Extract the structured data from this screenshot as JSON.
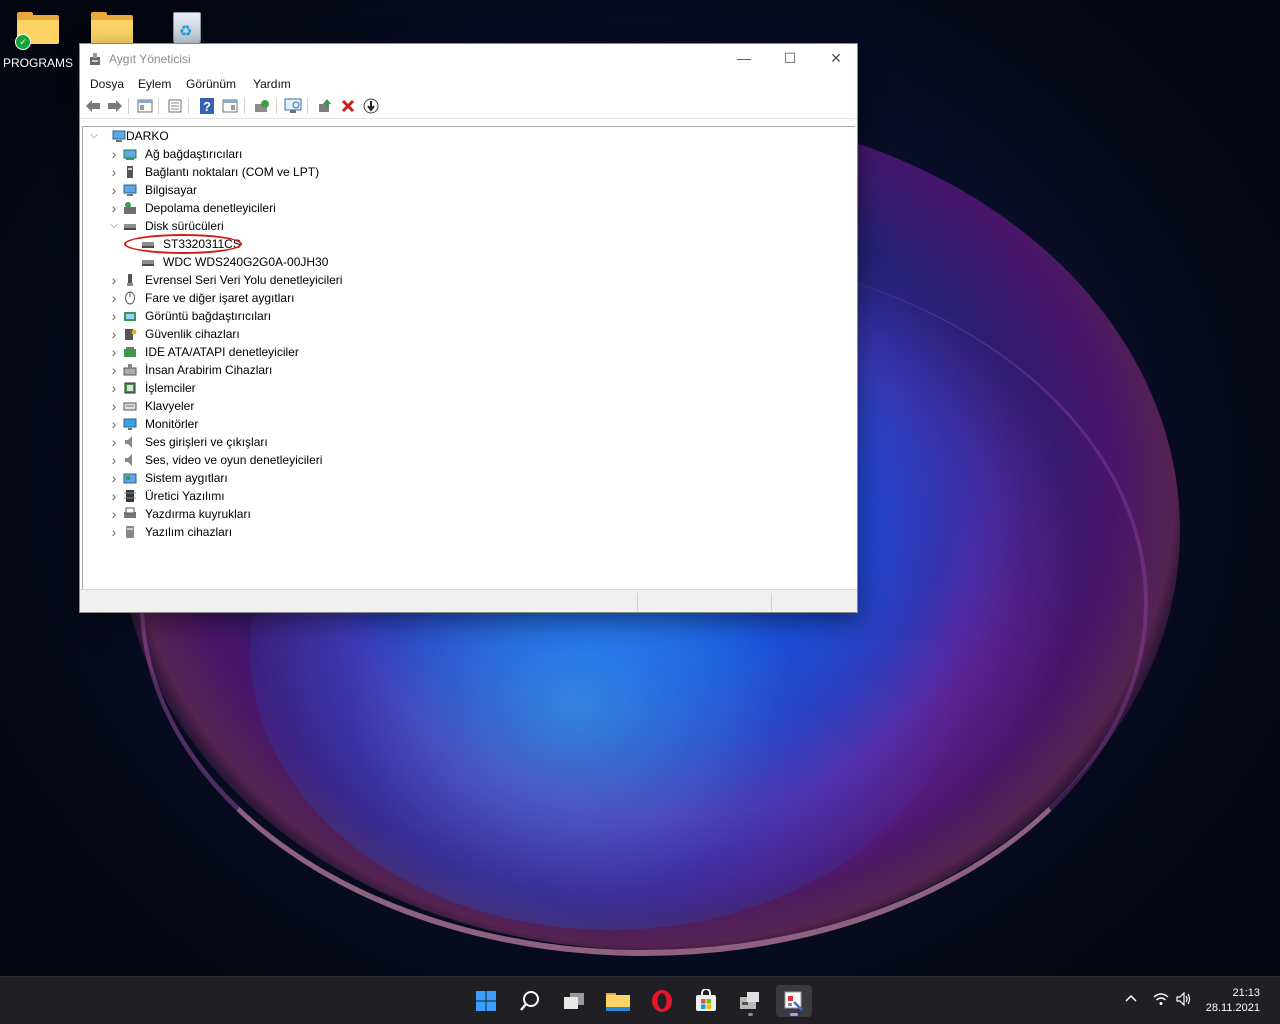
{
  "desktop": {
    "icons": [
      {
        "label": "PROGRAMS",
        "icon": "folder-with-check-icon"
      },
      {
        "label": "",
        "icon": "folder-icon"
      },
      {
        "label": "",
        "icon": "recycle-bin-icon"
      }
    ]
  },
  "window": {
    "title": "Aygıt Yöneticisi",
    "controls": {
      "minimize": "—",
      "maximize": "☐",
      "close": "✕"
    },
    "menu": [
      "Dosya",
      "Eylem",
      "Görünüm",
      "Yardım"
    ],
    "toolbar": [
      "back-arrow-icon",
      "forward-arrow-icon",
      "show-hide-tree-icon",
      "properties-icon",
      "help-icon",
      "view-icon",
      "update-driver-icon",
      "scan-hardware-icon",
      "add-driver-icon",
      "uninstall-icon",
      "download-icon"
    ],
    "tree": {
      "root": "DARKO",
      "categories": [
        {
          "label": "Ağ bağdaştırıcıları",
          "icon": "network-adapter-icon",
          "expanded": false
        },
        {
          "label": "Bağlantı noktaları (COM ve LPT)",
          "icon": "port-icon",
          "expanded": false
        },
        {
          "label": "Bilgisayar",
          "icon": "computer-icon",
          "expanded": false
        },
        {
          "label": "Depolama denetleyicileri",
          "icon": "storage-controller-icon",
          "expanded": false
        },
        {
          "label": "Disk sürücüleri",
          "icon": "disk-drive-icon",
          "expanded": true,
          "children": [
            "ST3320311CS",
            "WDC WDS240G2G0A-00JH30"
          ]
        },
        {
          "label": "Evrensel Seri Veri Yolu denetleyicileri",
          "icon": "usb-icon",
          "expanded": false
        },
        {
          "label": "Fare ve diğer işaret aygıtları",
          "icon": "mouse-icon",
          "expanded": false
        },
        {
          "label": "Görüntü bağdaştırıcıları",
          "icon": "display-adapter-icon",
          "expanded": false
        },
        {
          "label": "Güvenlik cihazları",
          "icon": "security-device-icon",
          "expanded": false
        },
        {
          "label": "IDE ATA/ATAPI denetleyiciler",
          "icon": "ide-controller-icon",
          "expanded": false
        },
        {
          "label": "İnsan Arabirim Cihazları",
          "icon": "hid-icon",
          "expanded": false
        },
        {
          "label": "İşlemciler",
          "icon": "processor-icon",
          "expanded": false
        },
        {
          "label": "Klavyeler",
          "icon": "keyboard-icon",
          "expanded": false
        },
        {
          "label": "Monitörler",
          "icon": "monitor-icon",
          "expanded": false
        },
        {
          "label": "Ses girişleri ve çıkışları",
          "icon": "audio-io-icon",
          "expanded": false
        },
        {
          "label": "Ses, video ve oyun denetleyicileri",
          "icon": "sound-video-icon",
          "expanded": false
        },
        {
          "label": "Sistem aygıtları",
          "icon": "system-device-icon",
          "expanded": false
        },
        {
          "label": "Üretici Yazılımı",
          "icon": "firmware-icon",
          "expanded": false
        },
        {
          "label": "Yazdırma kuyrukları",
          "icon": "printer-icon",
          "expanded": false
        },
        {
          "label": "Yazılım cihazları",
          "icon": "software-device-icon",
          "expanded": false
        }
      ]
    }
  },
  "taskbar": {
    "apps": [
      "start-icon",
      "search-icon",
      "task-view-icon",
      "file-explorer-icon",
      "opera-icon",
      "store-icon",
      "device-app-icon",
      "device-manager-icon"
    ],
    "tray": [
      "chevron-up-icon",
      "wifi-icon",
      "speaker-icon"
    ],
    "time": "21:13",
    "date": "28.11.2021"
  },
  "colors": {
    "accent": "#0078d4",
    "highlight_circle": "#d41a1a",
    "taskbar": "#1f1f24"
  }
}
